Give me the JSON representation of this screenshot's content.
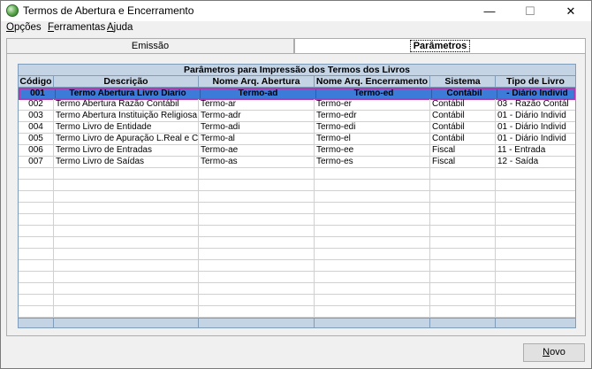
{
  "window": {
    "title": "Termos de Abertura e Encerramento"
  },
  "window_controls": {
    "minimize": "—",
    "maximize": "☐",
    "close": "✕"
  },
  "menu": {
    "items": [
      {
        "first": "O",
        "rest": "pções"
      },
      {
        "first": "F",
        "rest": "erramentas"
      },
      {
        "first": "A",
        "rest": "juda"
      }
    ]
  },
  "tabs": {
    "emissao": "Emissão",
    "parametros": "Parâmetros"
  },
  "grid": {
    "title": "Parâmetros para Impressão dos Termos dos Livros",
    "columns": [
      "Código",
      "Descrição",
      "Nome  Arq. Abertura",
      "Nome Arq. Encerramento",
      "Sistema",
      "Tipo de Livro"
    ],
    "rows": [
      [
        "001",
        "Termo Abertura Livro Diario",
        "Termo-ad",
        "Termo-ed",
        "Contábil",
        "- Diário Individ"
      ],
      [
        "002",
        "Termo Abertura Razão Contábil",
        "Termo-ar",
        "Termo-er",
        "Contábil",
        "03 - Razão Contál"
      ],
      [
        "003",
        "Termo Abertura Instituição Religiosa",
        "Termo-adr",
        "Termo-edr",
        "Contábil",
        "01 - Diário Individ"
      ],
      [
        "004",
        "Termo Livro de Entidade",
        "Termo-adi",
        "Termo-edi",
        "Contábil",
        "01 - Diário Individ"
      ],
      [
        "005",
        "Termo Livro de Apuração L.Real e CSL",
        "Termo-al",
        "Termo-el",
        "Contábil",
        "01 - Diário Individ"
      ],
      [
        "006",
        "Termo Livro de Entradas",
        "Termo-ae",
        "Termo-ee",
        "Fiscal",
        "11 - Entrada"
      ],
      [
        "007",
        "Termo Livro de Saídas",
        "Termo-as",
        "Termo-es",
        "Fiscal",
        "12 - Saída"
      ]
    ],
    "selected_row": 0,
    "empty_rows": 13
  },
  "buttons": {
    "novo_first": "N",
    "novo_rest": "ovo"
  },
  "colors": {
    "selection": "#3d7bd9",
    "header": "#c5d4e5",
    "selection_border": "#b03ab0"
  }
}
